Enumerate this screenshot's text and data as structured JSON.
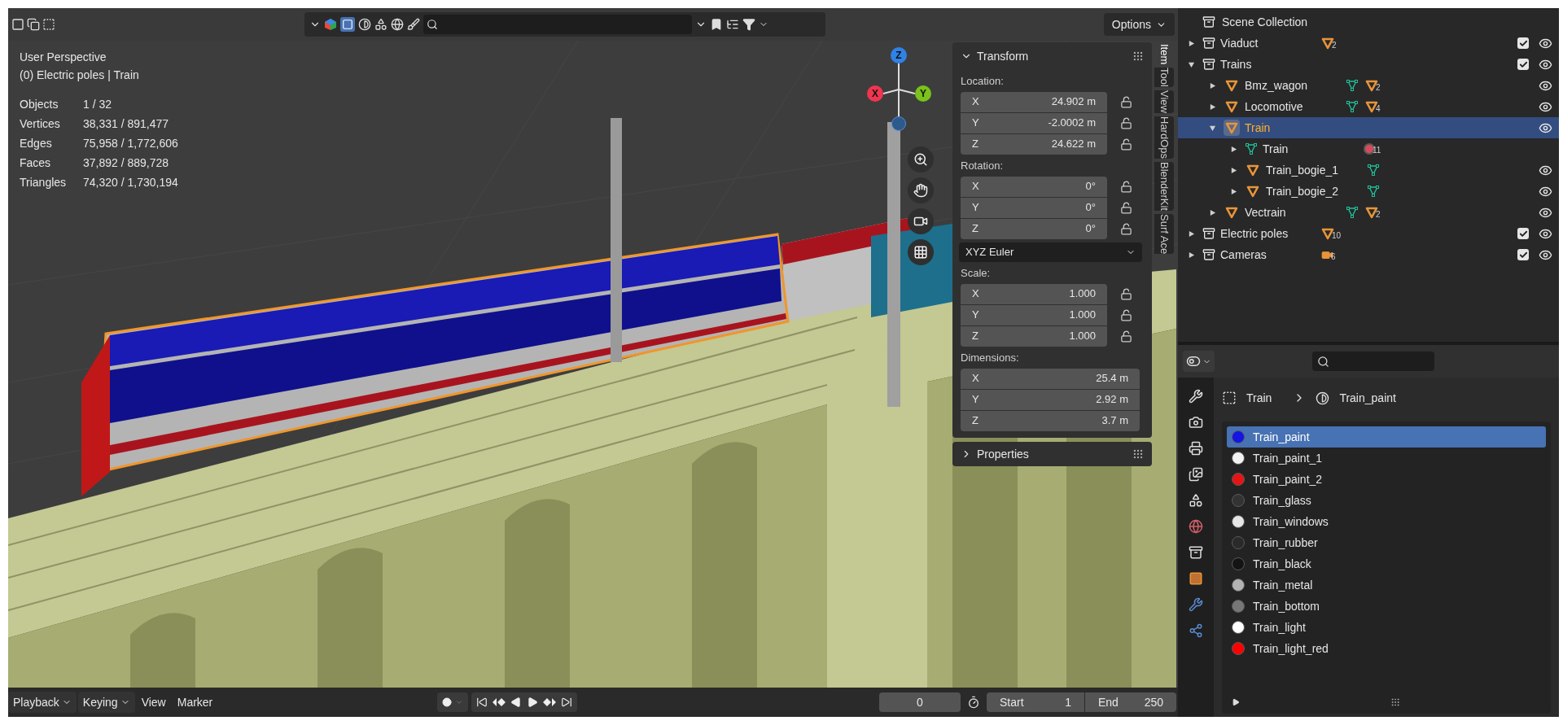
{
  "viewport_header": {
    "options_label": "Options"
  },
  "overlay": {
    "view_name": "User Perspective",
    "context": "(0) Electric poles | Train",
    "stats": [
      {
        "label": "Objects",
        "value": "1 / 32"
      },
      {
        "label": "Vertices",
        "value": "38,331 / 891,477"
      },
      {
        "label": "Edges",
        "value": "75,958 / 1,772,606"
      },
      {
        "label": "Faces",
        "value": "37,892 / 889,728"
      },
      {
        "label": "Triangles",
        "value": "74,320 / 1,730,194"
      }
    ]
  },
  "gizmo": {
    "axes": [
      {
        "label": "Z",
        "color": "#2f82e6"
      },
      {
        "label": "X",
        "color": "#f0354f"
      },
      {
        "label": "Y",
        "color": "#7ac21c"
      }
    ]
  },
  "transform": {
    "title": "Transform",
    "expanded": true,
    "sections": [
      {
        "label": "Location:",
        "lockable": true,
        "fields": [
          {
            "axis": "X",
            "value": "24.902 m"
          },
          {
            "axis": "Y",
            "value": "-2.0002 m"
          },
          {
            "axis": "Z",
            "value": "24.622 m"
          }
        ]
      },
      {
        "label": "Rotation:",
        "lockable": true,
        "fields": [
          {
            "axis": "X",
            "value": "0°"
          },
          {
            "axis": "Y",
            "value": "0°"
          },
          {
            "axis": "Z",
            "value": "0°"
          }
        ],
        "mode": "XYZ Euler"
      },
      {
        "label": "Scale:",
        "lockable": true,
        "fields": [
          {
            "axis": "X",
            "value": "1.000"
          },
          {
            "axis": "Y",
            "value": "1.000"
          },
          {
            "axis": "Z",
            "value": "1.000"
          }
        ]
      },
      {
        "label": "Dimensions:",
        "lockable": false,
        "fields": [
          {
            "axis": "X",
            "value": "25.4 m"
          },
          {
            "axis": "Y",
            "value": "2.92 m"
          },
          {
            "axis": "Z",
            "value": "3.7 m"
          }
        ]
      }
    ],
    "properties_title": "Properties",
    "properties_expanded": false
  },
  "side_tabs": [
    {
      "label": "Item",
      "selected": true
    },
    {
      "label": "Tool",
      "selected": false
    },
    {
      "label": "View",
      "selected": false
    },
    {
      "label": "HardOps",
      "selected": false
    },
    {
      "label": "BlenderKit",
      "selected": false
    },
    {
      "label": "Surf Ace",
      "selected": false
    }
  ],
  "outliner": {
    "root": "Scene Collection",
    "items": [
      {
        "kind": "collection",
        "name": "Viaduct",
        "expanded": false,
        "selected": false,
        "checked": true,
        "visible": true,
        "badges": [
          {
            "kind": "object",
            "count": "2"
          }
        ]
      },
      {
        "kind": "collection",
        "name": "Trains",
        "expanded": true,
        "selected": false,
        "checked": true,
        "visible": true,
        "children": [
          {
            "kind": "object",
            "name": "Bmz_wagon",
            "expanded": false,
            "selected": false,
            "visible": true,
            "badges": [
              {
                "kind": "mesh"
              },
              {
                "kind": "object",
                "count": "2"
              }
            ]
          },
          {
            "kind": "object",
            "name": "Locomotive",
            "expanded": false,
            "selected": false,
            "visible": true,
            "badges": [
              {
                "kind": "mesh"
              },
              {
                "kind": "object",
                "count": "4"
              }
            ]
          },
          {
            "kind": "object",
            "name": "Train",
            "expanded": true,
            "selected": true,
            "visible": true,
            "children": [
              {
                "kind": "mesh",
                "name": "Train",
                "expanded": false,
                "selected": false,
                "badges": [
                  {
                    "kind": "material",
                    "count": "11"
                  }
                ]
              },
              {
                "kind": "object",
                "name": "Train_bogie_1",
                "expanded": false,
                "selected": false,
                "visible": true,
                "badges": [
                  {
                    "kind": "mesh"
                  }
                ]
              },
              {
                "kind": "object",
                "name": "Train_bogie_2",
                "expanded": false,
                "selected": false,
                "visible": true,
                "badges": [
                  {
                    "kind": "mesh"
                  }
                ]
              }
            ]
          },
          {
            "kind": "object",
            "name": "Vectrain",
            "expanded": false,
            "selected": false,
            "visible": true,
            "badges": [
              {
                "kind": "mesh"
              },
              {
                "kind": "object",
                "count": "2"
              }
            ]
          }
        ]
      },
      {
        "kind": "collection",
        "name": "Electric poles",
        "expanded": false,
        "selected": false,
        "checked": true,
        "visible": true,
        "badges": [
          {
            "kind": "object",
            "count": "10"
          }
        ]
      },
      {
        "kind": "collection",
        "name": "Cameras",
        "expanded": false,
        "selected": false,
        "checked": true,
        "visible": true,
        "badges": [
          {
            "kind": "camera",
            "count": "6"
          }
        ]
      }
    ]
  },
  "properties": {
    "breadcrumb": {
      "object": "Train",
      "material": "Train_paint"
    },
    "materials": [
      {
        "name": "Train_paint",
        "color": "#1414e6",
        "selected": true
      },
      {
        "name": "Train_paint_1",
        "color": "#f2f2f2",
        "selected": false
      },
      {
        "name": "Train_paint_2",
        "color": "#e61414",
        "selected": false
      },
      {
        "name": "Train_glass",
        "color": "#333333",
        "selected": false
      },
      {
        "name": "Train_windows",
        "color": "#e6e6e6",
        "selected": false
      },
      {
        "name": "Train_rubber",
        "color": "#2a2a2a",
        "selected": false
      },
      {
        "name": "Train_black",
        "color": "#141414",
        "selected": false
      },
      {
        "name": "Train_metal",
        "color": "#b3b3b3",
        "selected": false
      },
      {
        "name": "Train_bottom",
        "color": "#777777",
        "selected": false
      },
      {
        "name": "Train_light",
        "color": "#ffffff",
        "selected": false
      },
      {
        "name": "Train_light_red",
        "color": "#ff0000",
        "selected": false
      }
    ]
  },
  "timeline": {
    "menus": [
      "Playback",
      "Keying",
      "View",
      "Marker"
    ],
    "current_frame": "0",
    "start_label": "Start",
    "start": "1",
    "end_label": "End",
    "end": "250"
  }
}
